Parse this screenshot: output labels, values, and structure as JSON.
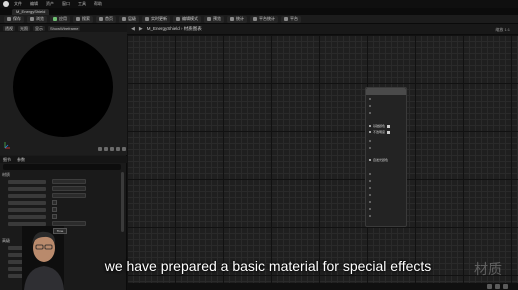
{
  "menu": {
    "items": [
      "文件",
      "编辑",
      "资产",
      "窗口",
      "工具",
      "帮助"
    ]
  },
  "document_tab": {
    "label": "M_EnergyShield"
  },
  "toolbar": {
    "buttons": [
      {
        "label": "保存",
        "icon": "save-icon"
      },
      {
        "label": "浏览",
        "icon": "browse-icon"
      },
      {
        "label": "应用",
        "icon": "apply-icon"
      },
      {
        "label": "搜索",
        "icon": "search-icon"
      },
      {
        "label": "首页",
        "icon": "home-icon"
      },
      {
        "label": "层级",
        "icon": "hierarchy-icon"
      },
      {
        "label": "实时更新",
        "icon": "live-update-icon"
      },
      {
        "label": "编辑模式",
        "icon": "edit-mode-icon"
      },
      {
        "label": "预览",
        "icon": "preview-icon"
      },
      {
        "label": "统计",
        "icon": "stats-icon"
      },
      {
        "label": "平台统计",
        "icon": "platform-stats-icon"
      },
      {
        "label": "平台",
        "icon": "platform-icon"
      }
    ]
  },
  "viewport": {
    "tabs": [
      "透视",
      "光照",
      "显示",
      "ShowWireframe"
    ]
  },
  "details": {
    "tabs": [
      "细节",
      "参数"
    ],
    "sections": [
      "材质",
      "高级"
    ]
  },
  "graph": {
    "breadcrumb": "M_EnergyShield",
    "breadcrumb_suffix": "材质图表",
    "zoom": "缩放 1:1"
  },
  "material_node": {
    "pins": [
      {
        "label": "基础颜色",
        "bright": true
      },
      {
        "label": "不透明度",
        "bright": true
      },
      {
        "label": "自发光颜色",
        "bright": true
      }
    ]
  },
  "tooltip": {
    "label": "Time"
  },
  "subtitle": {
    "text": "we have prepared a basic material for special effects"
  },
  "watermark": {
    "text": "材质"
  }
}
